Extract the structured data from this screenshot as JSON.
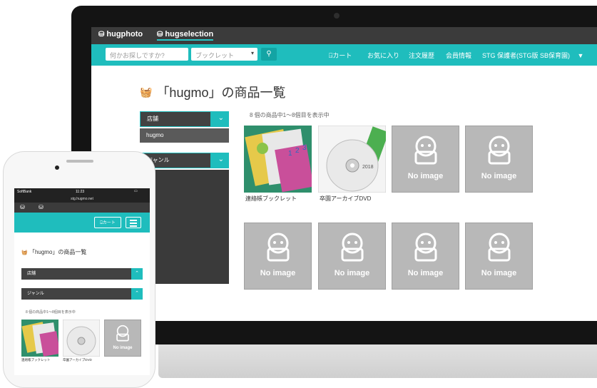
{
  "brands": [
    "hugphoto",
    "hugselection"
  ],
  "nav": {
    "search_placeholder": "何かお探しですか?",
    "category_select": "ブックレット",
    "links": [
      "カート",
      "お気に入り",
      "注文履歴",
      "会員情報",
      "STG 保護者(STG版 SB保育園)"
    ]
  },
  "page": {
    "title": "「hugmo」の商品一覧",
    "count_text": "8 個の商品中1～8個目を表示中"
  },
  "sidebar": {
    "store_header": "店舗",
    "store_item": "hugmo",
    "genre_header": "ジャンル"
  },
  "products": [
    {
      "name": "連絡帳ブックレット",
      "image": "booklet"
    },
    {
      "name": "卒園アーカイブDVD",
      "image": "dvd"
    },
    {
      "name": "",
      "image": "No image"
    },
    {
      "name": "",
      "image": "No image"
    },
    {
      "name": "",
      "image": "No image"
    },
    {
      "name": "",
      "image": "No image"
    },
    {
      "name": "",
      "image": "No image"
    },
    {
      "name": "",
      "image": "No image"
    }
  ],
  "dvd_label": "2018",
  "no_image_text": "No image",
  "phone": {
    "carrier": "SoftBank",
    "time": "11:23",
    "url": "stg.hugmo.net",
    "cart_label": "カート",
    "title": "「hugmo」の商品一覧",
    "store_header": "店舗",
    "genre_header": "ジャンル",
    "count_text": "8 個の商品中1～8個目を表示中",
    "products": [
      "連絡帳ブックレット",
      "卒園アーカイブDVD"
    ],
    "no_image_text": "No image"
  },
  "colors": {
    "accent": "#1fbdbd",
    "dark": "#3b3b3b",
    "placeholder": "#b8b8b8"
  }
}
